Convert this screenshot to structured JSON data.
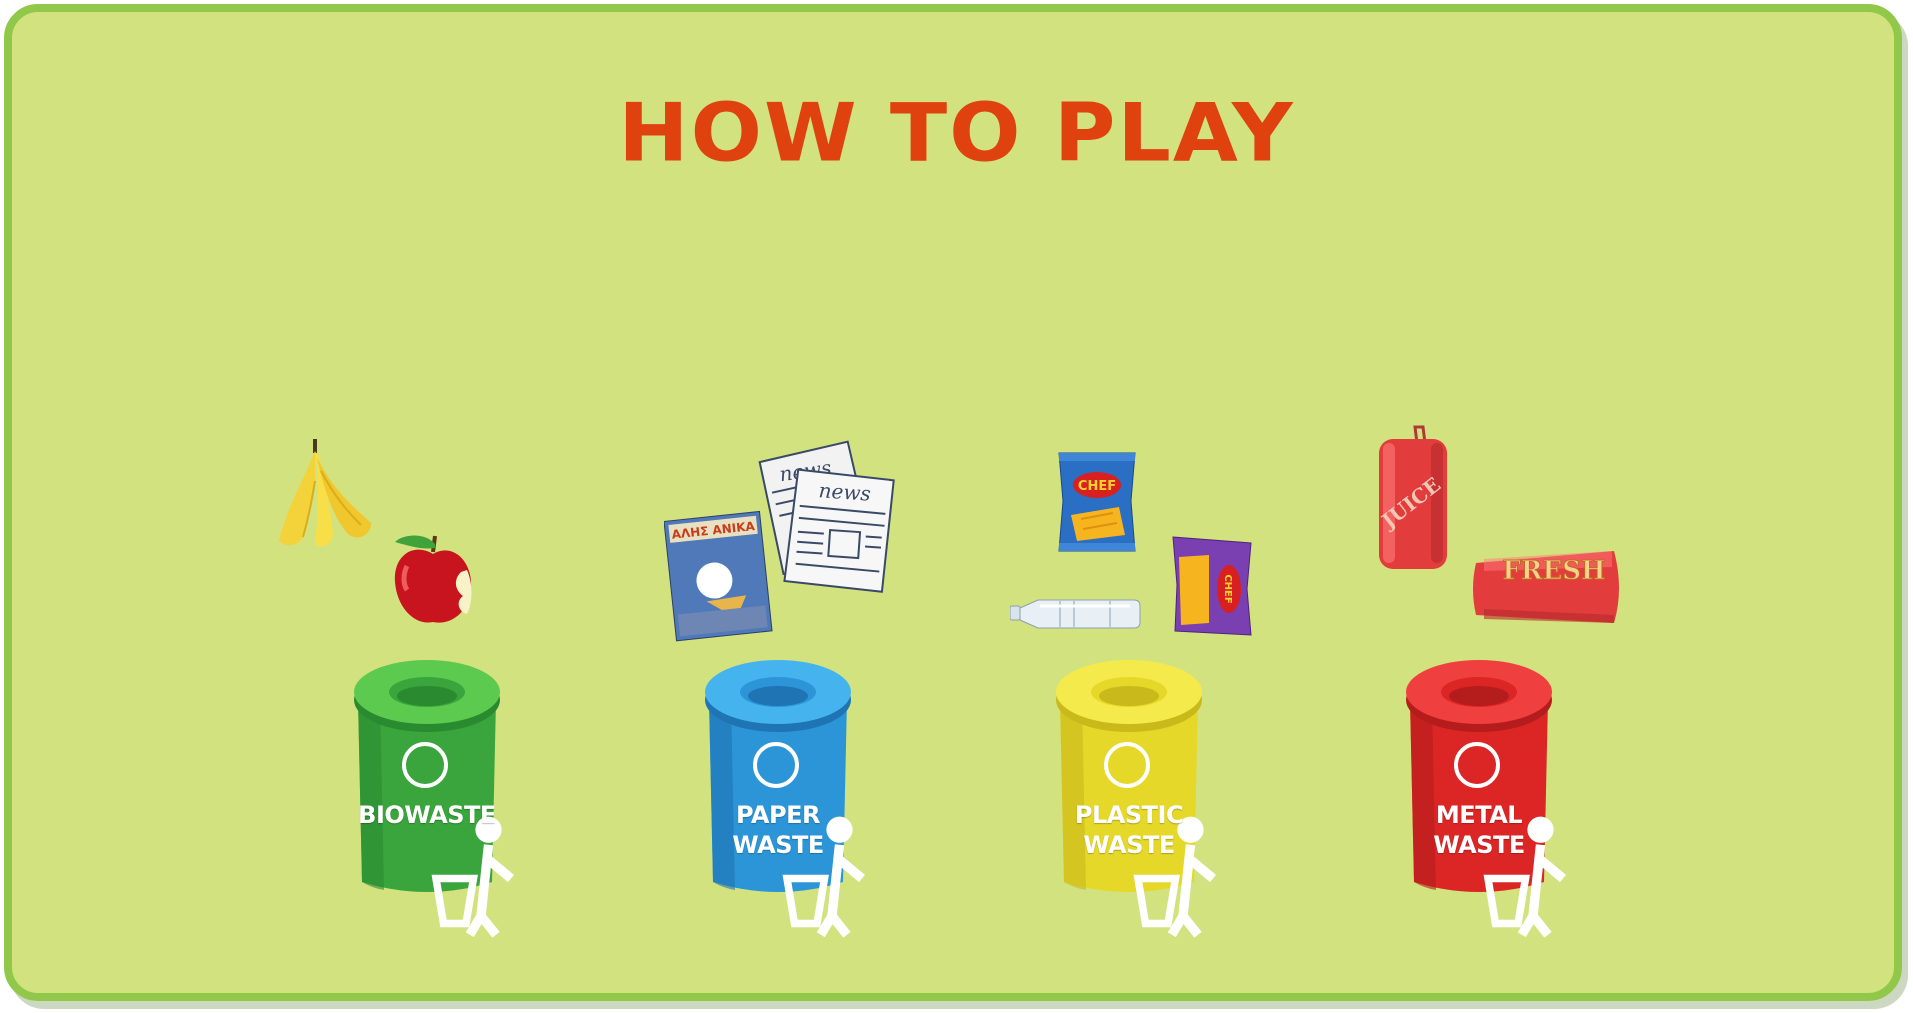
{
  "title": "HOW TO PLAY",
  "bins": [
    {
      "id": "bio",
      "label": "BIOWASTE",
      "color": "#3aa53c",
      "light": "#5cc94f",
      "dark": "#2a8a2f",
      "icon": "trash-symbol-icon"
    },
    {
      "id": "paper",
      "label": "PAPER\nWASTE",
      "color": "#2c95d8",
      "light": "#45b4ee",
      "dark": "#1f74b3",
      "icon": "trash-symbol-icon"
    },
    {
      "id": "plastic",
      "label": "PLASTIC\nWASTE",
      "color": "#e6d829",
      "light": "#f5ea4c",
      "dark": "#c9b91b",
      "icon": "trash-symbol-icon"
    },
    {
      "id": "metal",
      "label": "METAL\nWASTE",
      "color": "#dc2626",
      "light": "#ef3f3f",
      "dark": "#b51c1c",
      "icon": "trash-symbol-icon"
    }
  ],
  "items": {
    "banana": "banana-peel-icon",
    "apple": "apple-core-icon",
    "comic": "comic-book-icon",
    "newspaper": "newspaper-icon",
    "newspaper_text_1": "news",
    "newspaper_text_2": "news",
    "chips_blue": "chips-bag-icon",
    "chips_purple": "chips-bag-icon",
    "chips_brand": "CHEF",
    "bottle": "plastic-bottle-icon",
    "juice_can": "juice-can-icon",
    "juice_text": "JUICE",
    "fresh_can": "soda-can-icon",
    "fresh_text": "FRESH"
  }
}
